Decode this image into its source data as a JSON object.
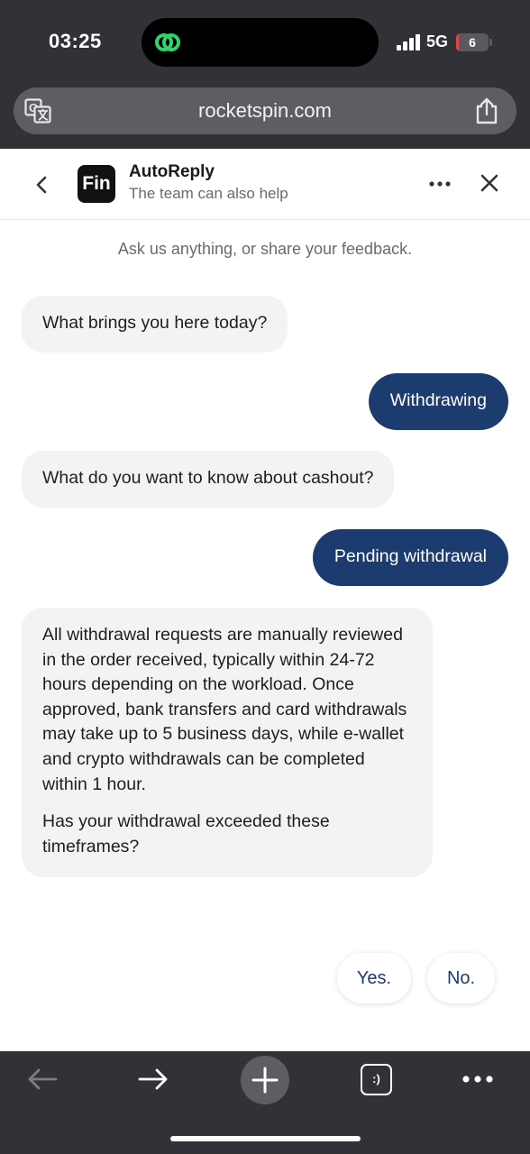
{
  "status_bar": {
    "time": "03:25",
    "network": "5G",
    "battery_level": "6",
    "battery_fraction": 0.06,
    "island_app_icon": "link-rings-icon",
    "accent_green": "#2fd36b"
  },
  "browser": {
    "url": "rocketspin.com",
    "left_icon": "translate-icon",
    "right_icon": "share-icon"
  },
  "chat_header": {
    "logo_text": "Fin",
    "title": "AutoReply",
    "subtitle": "The team can also help",
    "back_icon": "chevron-left-icon",
    "more_icon": "more-horizontal-icon",
    "close_icon": "close-icon"
  },
  "conversation": {
    "intro": "Ask us anything, or share your feedback.",
    "messages": [
      {
        "from": "bot",
        "text": "What brings you here today?"
      },
      {
        "from": "user",
        "text": "Withdrawing"
      },
      {
        "from": "bot",
        "text": "What do you want to know about cashout?"
      },
      {
        "from": "user",
        "text": "Pending withdrawal"
      },
      {
        "from": "bot",
        "paragraphs": [
          "All withdrawal requests are manually reviewed in the order received, typically within 24-72 hours depending on the workload. Once approved, bank transfers and card withdrawals may take up to 5 business days, while e-wallet and crypto withdrawals can be completed within 1 hour.",
          "Has your withdrawal exceeded these timeframes?"
        ]
      }
    ],
    "quick_replies": [
      "Yes.",
      "No."
    ]
  },
  "toolbar": {
    "tabs_label": ":)",
    "icons": [
      "back-arrow-icon",
      "forward-arrow-icon",
      "plus-icon",
      "tabs-icon",
      "more-horizontal-icon"
    ]
  },
  "colors": {
    "chrome": "#303237",
    "user_bubble": "#1c3b6e",
    "bot_bubble": "#f3f3f3",
    "quick_reply_text": "#1c3b6e"
  }
}
